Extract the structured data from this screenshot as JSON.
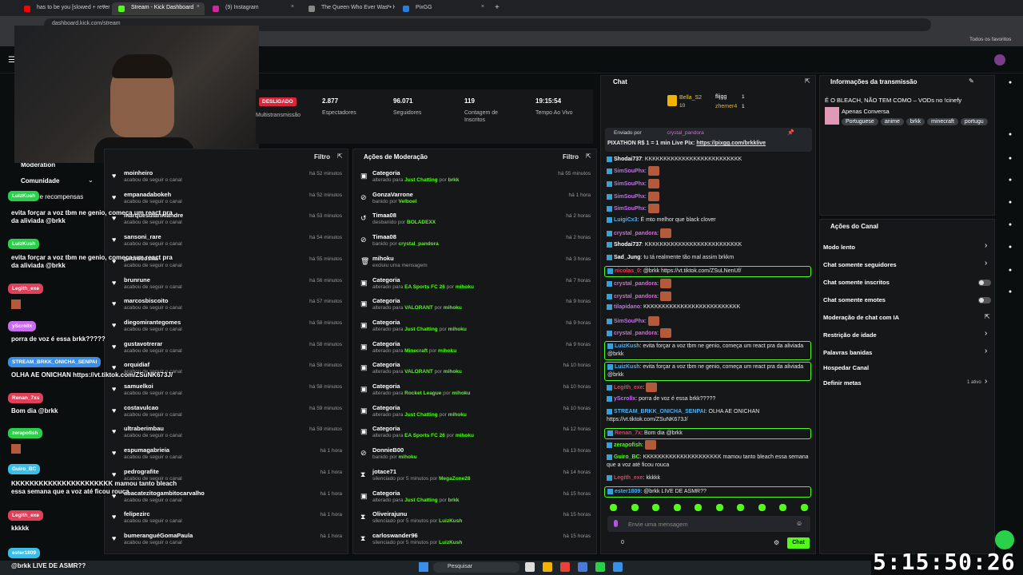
{
  "browser": {
    "tabs": [
      {
        "label": "has to be you [slowed + reverb]",
        "color": "#ff0000"
      },
      {
        "label": "Stream - Kick Dashboard",
        "color": "#53fc18"
      },
      {
        "label": "(9) Instagram",
        "color": "#d6249f"
      },
      {
        "label": "The Queen Who Ever Was • HBO",
        "color": "#888888"
      },
      {
        "label": "PixGG",
        "color": "#2a7ce0"
      }
    ],
    "url": "dashboard.kick.com/stream",
    "bookmarks": "Todos os favoritos"
  },
  "sidebar": {
    "moderation": "Moderation",
    "comunidade": "Comunidade",
    "drops": "Drops e recompensas"
  },
  "stats": {
    "status": "DESLIGADO",
    "multi": "Multistransmissão",
    "items": [
      {
        "value": "2.877",
        "label": "Espectadores"
      },
      {
        "value": "96.071",
        "label": "Seguidores"
      },
      {
        "value": "119",
        "label": "Contagem de Inscritos"
      },
      {
        "value": "19:15:54",
        "label": "Tempo Ao Vivo"
      }
    ]
  },
  "followers": {
    "filter": "Filtro",
    "rows": [
      {
        "name": "moinheiro",
        "sub": "acabou de seguir o canal",
        "time": "há 52 minutos"
      },
      {
        "name": "empanadabokeh",
        "sub": "acabou de seguir o canal",
        "time": "há 52 minutos"
      },
      {
        "name": "marquesdiarinlandre",
        "sub": "acabou de seguir o canal",
        "time": "há 53 minutos"
      },
      {
        "name": "sansoni_rare",
        "sub": "acabou de seguir o canal",
        "time": "há 54 minutos"
      },
      {
        "name": "pedrocostta",
        "sub": "acabou de seguir o canal",
        "time": "há 55 minutos"
      },
      {
        "name": "brunrune",
        "sub": "acabou de seguir o canal",
        "time": "há 56 minutos"
      },
      {
        "name": "marcosbiscoito",
        "sub": "acabou de seguir o canal",
        "time": "há 57 minutos"
      },
      {
        "name": "diegomirantegomes",
        "sub": "acabou de seguir o canal",
        "time": "há 58 minutos"
      },
      {
        "name": "gustavotrerar",
        "sub": "acabou de seguir o canal",
        "time": "há 58 minutos"
      },
      {
        "name": "orquidiaf",
        "sub": "acabou de seguir o canal",
        "time": "há 58 minutos"
      },
      {
        "name": "samuelkoi",
        "sub": "acabou de seguir o canal",
        "time": "há 58 minutos"
      },
      {
        "name": "costavulcao",
        "sub": "acabou de seguir o canal",
        "time": "há 59 minutos"
      },
      {
        "name": "ultraberimbau",
        "sub": "acabou de seguir o canal",
        "time": "há 59 minutos"
      },
      {
        "name": "espumagabrieia",
        "sub": "acabou de seguir o canal",
        "time": "há 1 hora"
      },
      {
        "name": "pedrografite",
        "sub": "acabou de seguir o canal",
        "time": "há 1 hora"
      },
      {
        "name": "abacatezitogambitocarvalho",
        "sub": "acabou de seguir o canal",
        "time": "há 1 hora"
      },
      {
        "name": "felipezirc",
        "sub": "acabou de seguir o canal",
        "time": "há 1 hora"
      },
      {
        "name": "bumeranguéGomaPaula",
        "sub": "acabou de seguir o canal",
        "time": "há 1 hora"
      }
    ]
  },
  "moderation": {
    "title": "Ações de Moderação",
    "filter": "Filtro",
    "rows": [
      {
        "icon": "▣",
        "name": "Categoria",
        "pre": "alterado para ",
        "cat": "Just Chatting",
        "mid": " por ",
        "by": "brkk",
        "time": "há 55 minutos"
      },
      {
        "icon": "⊘",
        "name": "GonzaVarrone",
        "pre": "banido por ",
        "cat": "",
        "mid": "",
        "by": "Velboel",
        "time": "há 1 hora"
      },
      {
        "icon": "↺",
        "name": "Timaa08",
        "pre": "desbanido por ",
        "cat": "",
        "mid": "",
        "by": "BOLADEXX",
        "time": "há 2 horas"
      },
      {
        "icon": "⊘",
        "name": "Timaa08",
        "pre": "banido por ",
        "cat": "",
        "mid": "",
        "by": "crystal_pandora",
        "time": "há 2 horas"
      },
      {
        "icon": "🗑",
        "name": "mihoku",
        "pre": "excluiu uma mensagem",
        "cat": "",
        "mid": "",
        "by": "",
        "time": "há 3 horas"
      },
      {
        "icon": "▣",
        "name": "Categoria",
        "pre": "alterado para ",
        "cat": "EA Sports FC 26",
        "mid": " por ",
        "by": "mihoku",
        "time": "há 7 horas"
      },
      {
        "icon": "▣",
        "name": "Categoria",
        "pre": "alterado para ",
        "cat": "VALORANT",
        "mid": " por ",
        "by": "mihoku",
        "time": "há 9 horas"
      },
      {
        "icon": "▣",
        "name": "Categoria",
        "pre": "alterado para ",
        "cat": "Just Chatting",
        "mid": " por ",
        "by": "mihoku",
        "time": "há 9 horas"
      },
      {
        "icon": "▣",
        "name": "Categoria",
        "pre": "alterado para ",
        "cat": "Minecraft",
        "mid": " por ",
        "by": "mihoku",
        "time": "há 9 horas"
      },
      {
        "icon": "▣",
        "name": "Categoria",
        "pre": "alterado para ",
        "cat": "VALORANT",
        "mid": " por ",
        "by": "mihoku",
        "time": "há 10 horas"
      },
      {
        "icon": "▣",
        "name": "Categoria",
        "pre": "alterado para ",
        "cat": "Rocket League",
        "mid": " por ",
        "by": "mihoku",
        "time": "há 10 horas"
      },
      {
        "icon": "▣",
        "name": "Categoria",
        "pre": "alterado para ",
        "cat": "Just Chatting",
        "mid": " por ",
        "by": "mihoku",
        "time": "há 10 horas"
      },
      {
        "icon": "▣",
        "name": "Categoria",
        "pre": "alterado para ",
        "cat": "EA Sports FC 26",
        "mid": " por ",
        "by": "mihoku",
        "time": "há 12 horas"
      },
      {
        "icon": "⊘",
        "name": "DonnieB00",
        "pre": "banido por ",
        "cat": "",
        "mid": "",
        "by": "mihoku",
        "time": "há 13 horas"
      },
      {
        "icon": "⧗",
        "name": "jotace71",
        "pre": "silenciado por 5 minutos por ",
        "cat": "",
        "mid": "",
        "by": "MegaZone28",
        "time": "há 14 horas"
      },
      {
        "icon": "▣",
        "name": "Categoria",
        "pre": "alterado para ",
        "cat": "Just Chatting",
        "mid": " por ",
        "by": "brkk",
        "time": "há 15 horas"
      },
      {
        "icon": "⧗",
        "name": "Oliveirajunu",
        "pre": "silenciado por 5 minutos por ",
        "cat": "",
        "mid": "",
        "by": "LuizKush",
        "time": "há 15 horas"
      },
      {
        "icon": "⧗",
        "name": "carloswander96",
        "pre": "silenciado por 5 minutos por ",
        "cat": "",
        "mid": "",
        "by": "LuizKush",
        "time": "há 15 horas"
      }
    ]
  },
  "chat": {
    "title": "Chat",
    "top": [
      {
        "name": "Bella_S2",
        "count": "10"
      },
      {
        "name": "flijgg",
        "count": "1"
      },
      {
        "name": "zhemer4",
        "count": "1"
      }
    ],
    "pinned": {
      "by": "Enviado por",
      "user": "crystal_pandora",
      "text": "PIXATHON R$ 1 = 1 min Live Pix: ",
      "link": "https://pixgg.com/brkklive"
    },
    "messages": [
      {
        "user": "Shodai737",
        "color": "#ffffff",
        "text": "KKKKKKKKKKKKKKKKKKKKKKKKKK",
        "emote": false,
        "hl": false
      },
      {
        "user": "SimSouPhx",
        "color": "#c86cf0",
        "text": "",
        "emote": true,
        "hl": false
      },
      {
        "user": "SimSouPhx",
        "color": "#c86cf0",
        "text": "",
        "emote": true,
        "hl": false
      },
      {
        "user": "SimSouPhx",
        "color": "#c86cf0",
        "text": "",
        "emote": true,
        "hl": false
      },
      {
        "user": "SimSouPhx",
        "color": "#c86cf0",
        "text": "",
        "emote": true,
        "hl": false
      },
      {
        "user": "LuigiCx3",
        "color": "#4fb0f0",
        "text": "É mto melhor que black clover",
        "emote": false,
        "hl": false
      },
      {
        "user": "crystal_pandora",
        "color": "#d46cd0",
        "text": "",
        "emote": true,
        "hl": false
      },
      {
        "user": "Shodai737",
        "color": "#ffffff",
        "text": "KKKKKKKKKKKKKKKKKKKKKKKKKK",
        "emote": false,
        "hl": false
      },
      {
        "user": "Sad_Jung",
        "color": "#ffffff",
        "text": "tu tá realmente tão mal assim brkkm",
        "emote": false,
        "hl": false
      },
      {
        "user": "nicolas_0",
        "color": "#e0405a",
        "text": "@brkk https://vt.tiktok.com/ZSuLNenUf/",
        "emote": false,
        "hl": true
      },
      {
        "user": "crystal_pandora",
        "color": "#d46cd0",
        "text": "",
        "emote": true,
        "hl": false
      },
      {
        "user": "crystal_pandora",
        "color": "#d46cd0",
        "text": "",
        "emote": true,
        "hl": false
      },
      {
        "user": "tilapidano",
        "color": "#c86cf0",
        "text": "KKKKKKKKKKKKKKKKKKKKKKKKKK",
        "emote": false,
        "hl": false
      },
      {
        "user": "SimSouPhx",
        "color": "#c86cf0",
        "text": "",
        "emote": true,
        "hl": false
      },
      {
        "user": "crystal_pandora",
        "color": "#d46cd0",
        "text": "",
        "emote": true,
        "hl": false
      },
      {
        "user": "LuizKush",
        "color": "#4fb0f0",
        "text": "evita forçar a voz tbm ne genio, começa um react pra da aliviada @brkk",
        "emote": false,
        "hl": true
      },
      {
        "user": "LuizKush",
        "color": "#4fb0f0",
        "text": "evita forçar a voz tbm ne genio, começa um react pra da aliviada @brkk",
        "emote": false,
        "hl": true
      },
      {
        "user": "Legith_exe",
        "color": "#e0405a",
        "text": "",
        "emote": true,
        "hl": false
      },
      {
        "user": "yScrollx",
        "color": "#c86cf0",
        "text": "porra de voz é essa brkk?????",
        "emote": false,
        "hl": false
      },
      {
        "user": "STREAM_BRKK_ONICHA_SENPAI",
        "color": "#4fb0f0",
        "text": "OLHA AE ONICHAN https://vt.tiktok.com/ZSuNK673J/",
        "emote": false,
        "hl": false
      },
      {
        "user": "Renan_7x",
        "color": "#e0405a",
        "text": "Bom dia @brkk",
        "emote": false,
        "hl": true
      },
      {
        "user": "zerapofish",
        "color": "#53fc18",
        "text": "",
        "emote": true,
        "hl": false
      },
      {
        "user": "Guiro_BC",
        "color": "#53fc18",
        "text": "KKKKKKKKKKKKKKKKKKKKK mamou tanto bleach essa semana que a voz até ficou rouca",
        "emote": false,
        "hl": false
      },
      {
        "user": "Legith_exe",
        "color": "#e0405a",
        "text": "kkkkk",
        "emote": false,
        "hl": false
      },
      {
        "user": "ester1809",
        "color": "#4fb0f0",
        "text": "@brkk LIVE DE ASMR??",
        "emote": false,
        "hl": true
      }
    ],
    "placeholder": "Envie uma mensagem",
    "count": "0",
    "send": "Chat"
  },
  "info": {
    "title": "Informações da transmissão",
    "stream_title": "É O BLEACH, NÃO TEM COMO – VODs no !cinefy",
    "category": "Apenas Conversa",
    "tags": [
      "Portuguese",
      "anime",
      "brkk",
      "minecraft",
      "portugu"
    ]
  },
  "channel": {
    "title": "Ações do Canal",
    "items": [
      {
        "label": "Modo lento",
        "ctl": "arrow"
      },
      {
        "label": "Chat somente seguidores",
        "ctl": "arrow"
      },
      {
        "label": "Chat somente inscritos",
        "ctl": "toggle"
      },
      {
        "label": "Chat somente emotes",
        "ctl": "toggle"
      },
      {
        "label": "Moderação de chat com IA",
        "ctl": "ext"
      },
      {
        "label": "Restrição de idade",
        "ctl": "arrow"
      },
      {
        "label": "Palavras banidas",
        "ctl": "arrow"
      },
      {
        "label": "Hospedar Canal",
        "ctl": "none"
      },
      {
        "label": "Definir metas",
        "ctl": "arrow"
      }
    ],
    "active": "1 ativo"
  },
  "overlay": {
    "timer": "5:15:50:26",
    "bubbles": [
      {
        "name": "LuizKush",
        "text": "evita forçar a voz tbm ne genio, começa um react pra da aliviada @brkk"
      },
      {
        "name": "LuizKush",
        "text": "evita forçar a voz tbm ne genio, começa um react pra da aliviada @brkk"
      },
      {
        "name": "Legith_exe",
        "text": ""
      },
      {
        "name": "yScrollx",
        "text": "porra de voz é essa brkk?????"
      },
      {
        "name": "STREAM_BRKK_ONICHA_SENPAI",
        "text": "OLHA AE ONICHAN https://vt.tiktok.com/ZSuNK673J/"
      },
      {
        "name": "Renan_7xs",
        "text": "Bom dia @brkk"
      },
      {
        "name": "zerapofish",
        "text": ""
      },
      {
        "name": "Guiro_BC",
        "text": "KKKKKKKKKKKKKKKKKKKKKK mamou tanto bleach essa semana que a voz até ficou rouca"
      },
      {
        "name": "Legith_exe",
        "text": "kkkkk"
      },
      {
        "name": "ester1809",
        "text": "@brkk LIVE DE ASMR??"
      }
    ]
  },
  "taskbar": {
    "search": "Pesquisar"
  }
}
